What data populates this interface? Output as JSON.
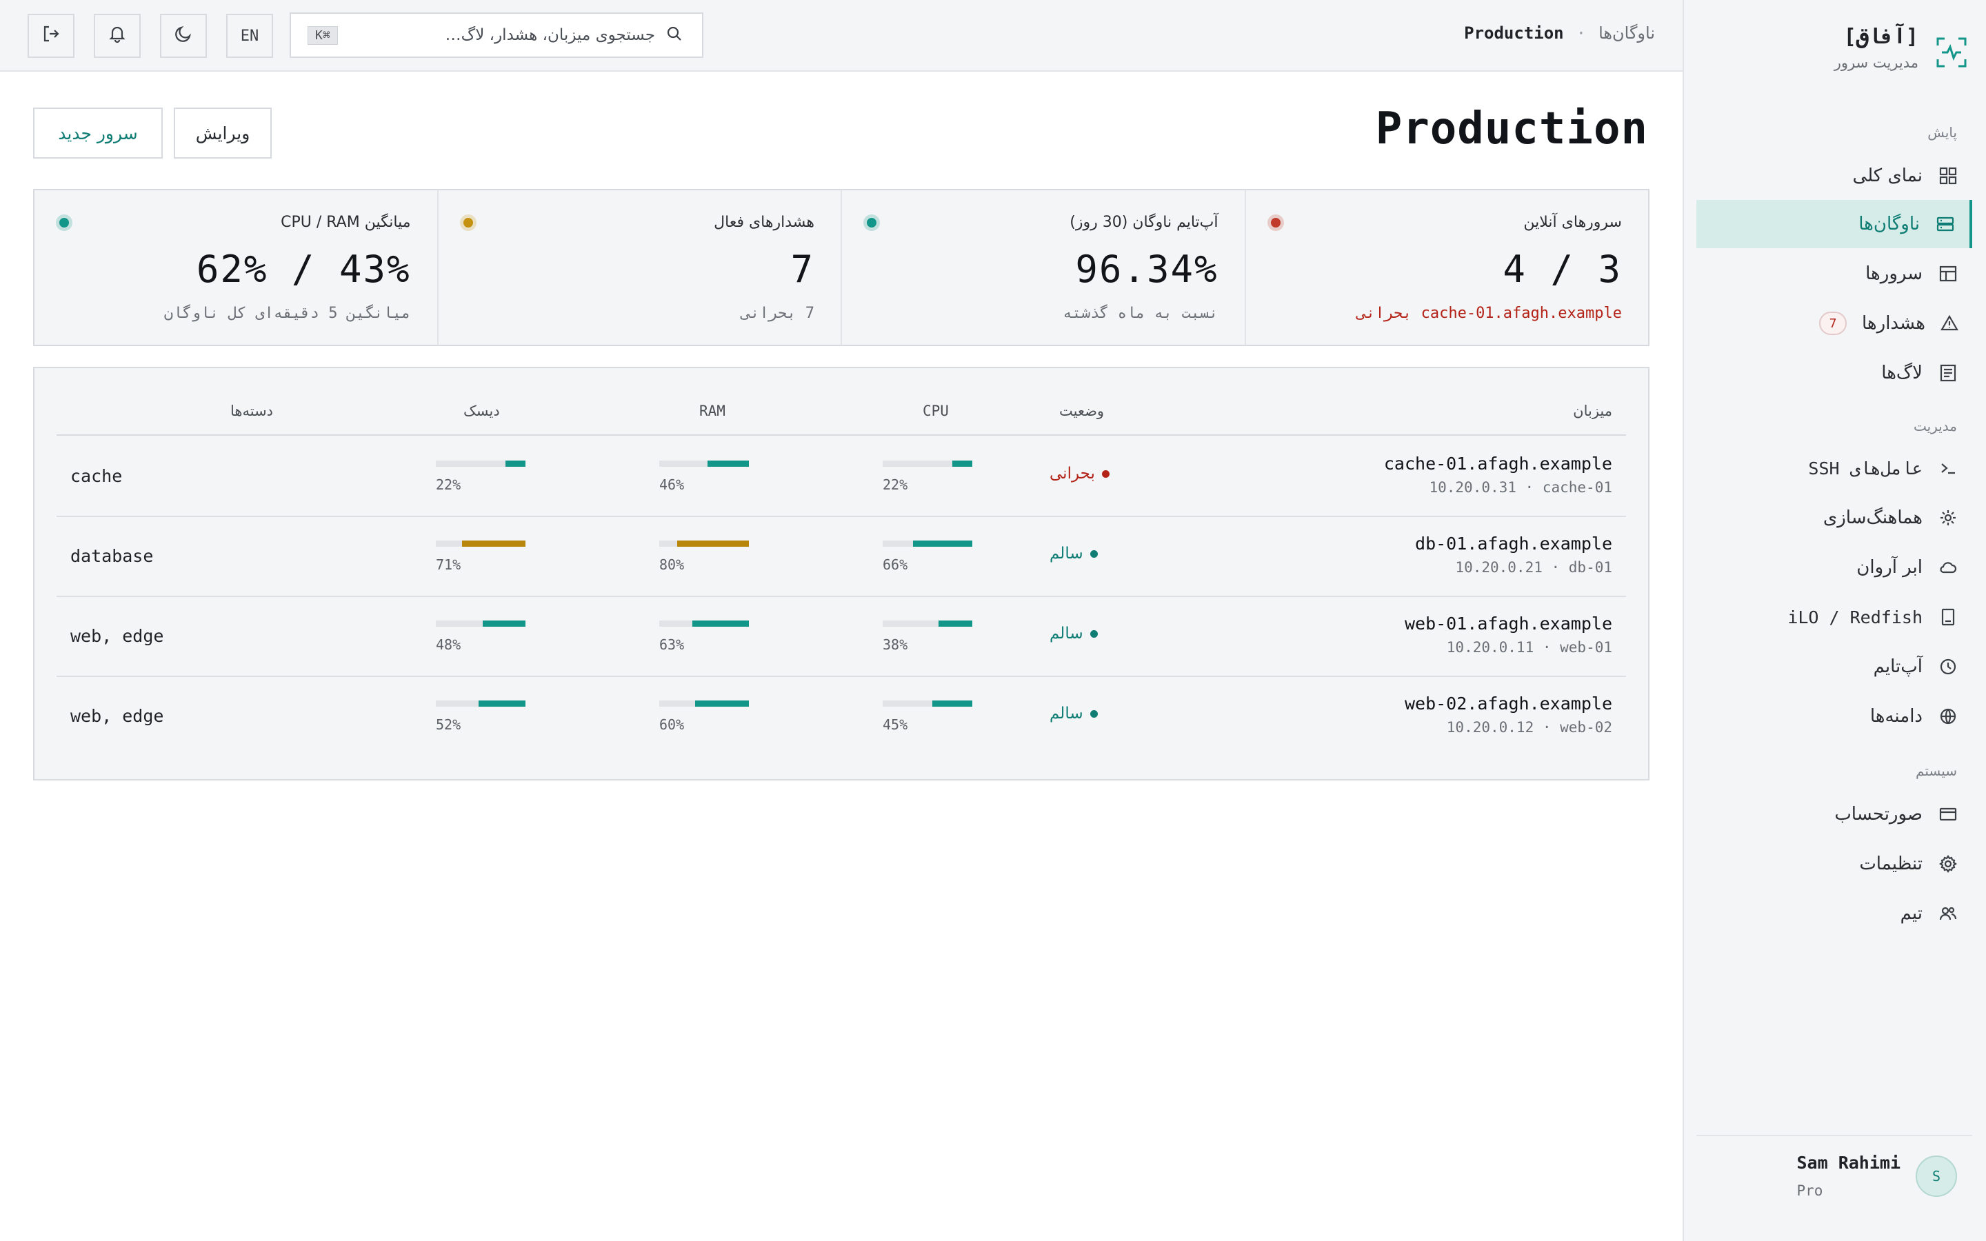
{
  "brand": {
    "name": "[آفاق]",
    "subtitle": "مدیریت سرور"
  },
  "sidebar": {
    "sections": [
      {
        "label": "پایش"
      },
      {
        "label": "مدیریت"
      },
      {
        "label": "سیستم"
      }
    ],
    "items": [
      {
        "label": "نمای کلی",
        "icon": "dashboard-icon"
      },
      {
        "label": "ناوگان‌ها",
        "icon": "server-stack-icon",
        "active": true
      },
      {
        "label": "سرورها",
        "icon": "table-icon"
      },
      {
        "label": "هشدارها",
        "icon": "warning-icon",
        "badge": "7"
      },
      {
        "label": "لاگ‌ها",
        "icon": "log-icon"
      },
      {
        "label": "عامل‌های SSH",
        "icon": "terminal-icon"
      },
      {
        "label": "هماهنگ‌سازی",
        "icon": "sync-icon"
      },
      {
        "label": "ابر آروان",
        "icon": "cloud-icon"
      },
      {
        "label": "iLO / Redfish",
        "icon": "hardware-icon"
      },
      {
        "label": "آپ‌تایم",
        "icon": "clock-icon"
      },
      {
        "label": "دامنه‌ها",
        "icon": "globe-icon"
      },
      {
        "label": "صورتحساب",
        "icon": "card-icon"
      },
      {
        "label": "تنظیمات",
        "icon": "gear-icon"
      },
      {
        "label": "تیم",
        "icon": "team-icon"
      }
    ]
  },
  "user": {
    "name": "Sam Rahimi",
    "plan": "Pro",
    "initial": "S"
  },
  "topbar": {
    "breadcrumb_root": "ناوگان‌ها",
    "breadcrumb_sep": "·",
    "breadcrumb_current": "Production",
    "search_placeholder": "جستجوی میزبان، هشدار، لاگ…",
    "search_shortcut": "K⌘",
    "lang": "EN"
  },
  "page": {
    "title": "Production",
    "edit_label": "ویرایش",
    "new_server_label": "سرور جدید"
  },
  "stats": [
    {
      "label": "سرورهای آنلاین",
      "value": "3 / 4",
      "note": "cache-01.afagh.example  بحرانی",
      "note_tone": "red",
      "dot_color": "#c0392b"
    },
    {
      "label": "آپ‌تایم ناوگان (30 روز)",
      "value": "96.34%",
      "note": "نسبت به ماه گذشته",
      "note_tone": "muted",
      "dot_color": "#12968a"
    },
    {
      "label": "هشدارهای فعال",
      "value": "7",
      "note": "7 بحرانی",
      "note_tone": "muted",
      "dot_color": "#c4920f"
    },
    {
      "label": "میانگین CPU / RAM",
      "value": "43% / 62%",
      "note": "میانگین 5 دقیقه‌ای کل ناوگان",
      "note_tone": "muted",
      "dot_color": "#12968a"
    }
  ],
  "table": {
    "headers": {
      "host": "میزبان",
      "status": "وضعیت",
      "cpu": "CPU",
      "ram": "RAM",
      "disk": "دیسک",
      "groups": "دسته‌ها"
    },
    "rows": [
      {
        "host": "cache-01.afagh.example",
        "ip": "10.20.0.31 · cache-01",
        "status": "بحرانی",
        "status_tone": "critical",
        "cpu": 22,
        "ram": 46,
        "disk": 22,
        "cpu_label": "22%",
        "ram_label": "46%",
        "disk_label": "22%",
        "groups": "cache"
      },
      {
        "host": "db-01.afagh.example",
        "ip": "10.20.0.21 · db-01",
        "status": "سالم",
        "status_tone": "healthy",
        "cpu": 66,
        "ram": 80,
        "disk": 71,
        "cpu_label": "66%",
        "ram_label": "80%",
        "disk_label": "71%",
        "groups": "database"
      },
      {
        "host": "web-01.afagh.example",
        "ip": "10.20.0.11 · web-01",
        "status": "سالم",
        "status_tone": "healthy",
        "cpu": 38,
        "ram": 63,
        "disk": 48,
        "cpu_label": "38%",
        "ram_label": "63%",
        "disk_label": "48%",
        "groups": "web, edge"
      },
      {
        "host": "web-02.afagh.example",
        "ip": "10.20.0.12 · web-02",
        "status": "سالم",
        "status_tone": "healthy",
        "cpu": 45,
        "ram": 60,
        "disk": 52,
        "cpu_label": "45%",
        "ram_label": "60%",
        "disk_label": "52%",
        "groups": "web, edge"
      }
    ]
  },
  "colors": {
    "accent": "#12968a",
    "warning": "#b8860b",
    "critical": "#b42318",
    "healthy": "#0f7d74"
  }
}
